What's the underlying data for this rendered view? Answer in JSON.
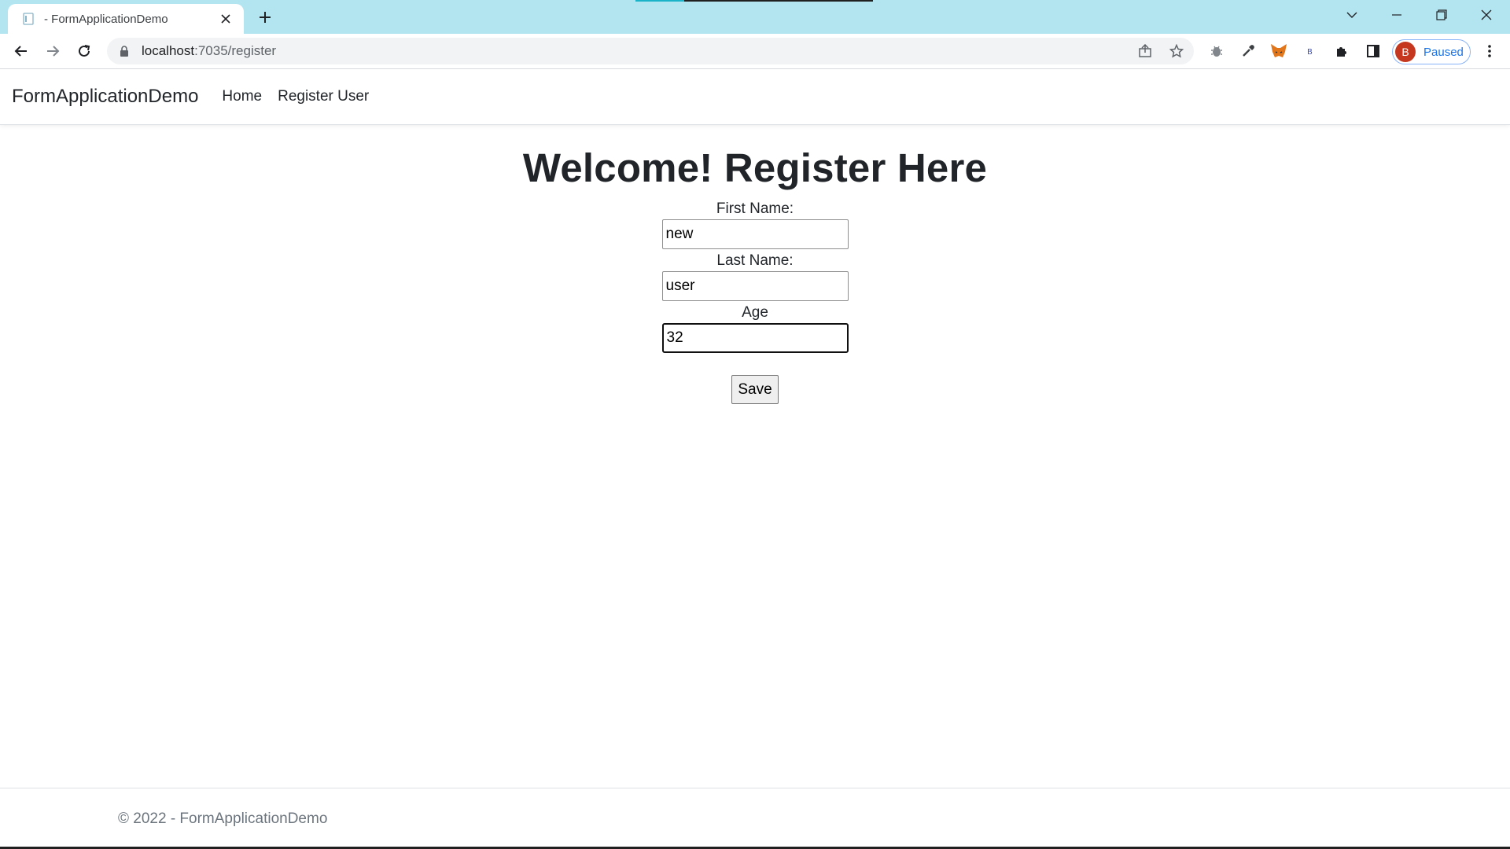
{
  "browser": {
    "tab_title": "- FormApplicationDemo",
    "url_host": "localhost",
    "url_path": ":7035/register",
    "profile_initial": "B",
    "profile_status": "Paused",
    "accent_color": "#b3e5f0"
  },
  "icons": {
    "back": "arrow-left-icon",
    "forward": "arrow-right-icon",
    "reload": "reload-icon",
    "lock": "lock-icon",
    "share": "share-icon",
    "bookmark": "star-icon",
    "extensions": [
      "bug-icon",
      "eyedropper-icon",
      "fox-icon",
      "b-extension-icon",
      "puzzle-icon",
      "side-panel-icon"
    ],
    "menu": "kebab-menu-icon"
  },
  "navbar": {
    "brand": "FormApplicationDemo",
    "links": [
      "Home",
      "Register User"
    ]
  },
  "main": {
    "heading": "Welcome! Register Here",
    "fields": [
      {
        "label": "First Name:",
        "value": "new"
      },
      {
        "label": "Last Name:",
        "value": "user"
      },
      {
        "label": "Age",
        "value": "32"
      }
    ],
    "save_label": "Save"
  },
  "footer": {
    "text": "© 2022 - FormApplicationDemo"
  }
}
